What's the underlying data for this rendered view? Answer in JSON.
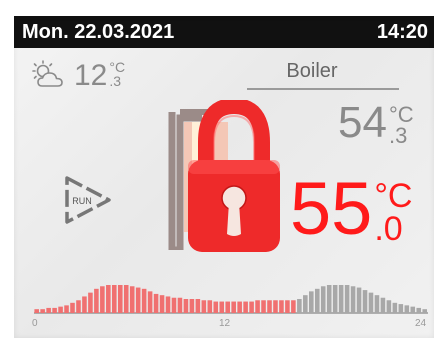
{
  "header": {
    "date": "Mon.  22.03.2021",
    "time": "14:20"
  },
  "outdoor": {
    "icon": "partly-cloudy-icon",
    "temp_int": "12",
    "temp_unit": "°C",
    "temp_dec": ".3"
  },
  "boiler": {
    "label": "Boiler",
    "actual": {
      "int": "54",
      "unit": "°C",
      "dec": ".3"
    },
    "target": {
      "int": "55",
      "unit": "°C",
      "dec": ".0"
    },
    "run_label": "RUN",
    "locked": true
  },
  "colors": {
    "accent": "#ff1a1a",
    "lock": "#ee2a2a",
    "bar_active": "#f07070",
    "bar_inactive": "#a8a8a8"
  },
  "chart_data": {
    "type": "bar",
    "xticks": [
      "0",
      "12",
      "24"
    ],
    "active_bar_count": 44,
    "values": [
      3,
      3,
      4,
      4,
      5,
      6,
      8,
      10,
      13,
      16,
      19,
      21,
      22,
      22,
      22,
      22,
      21,
      20,
      19,
      17,
      15,
      14,
      13,
      12,
      12,
      11,
      11,
      11,
      10,
      10,
      9,
      9,
      9,
      9,
      9,
      9,
      9,
      10,
      10,
      10,
      10,
      10,
      10,
      10,
      11,
      14,
      17,
      19,
      21,
      22,
      22,
      22,
      22,
      21,
      20,
      18,
      16,
      14,
      12,
      10,
      8,
      7,
      6,
      5,
      4,
      3
    ]
  }
}
